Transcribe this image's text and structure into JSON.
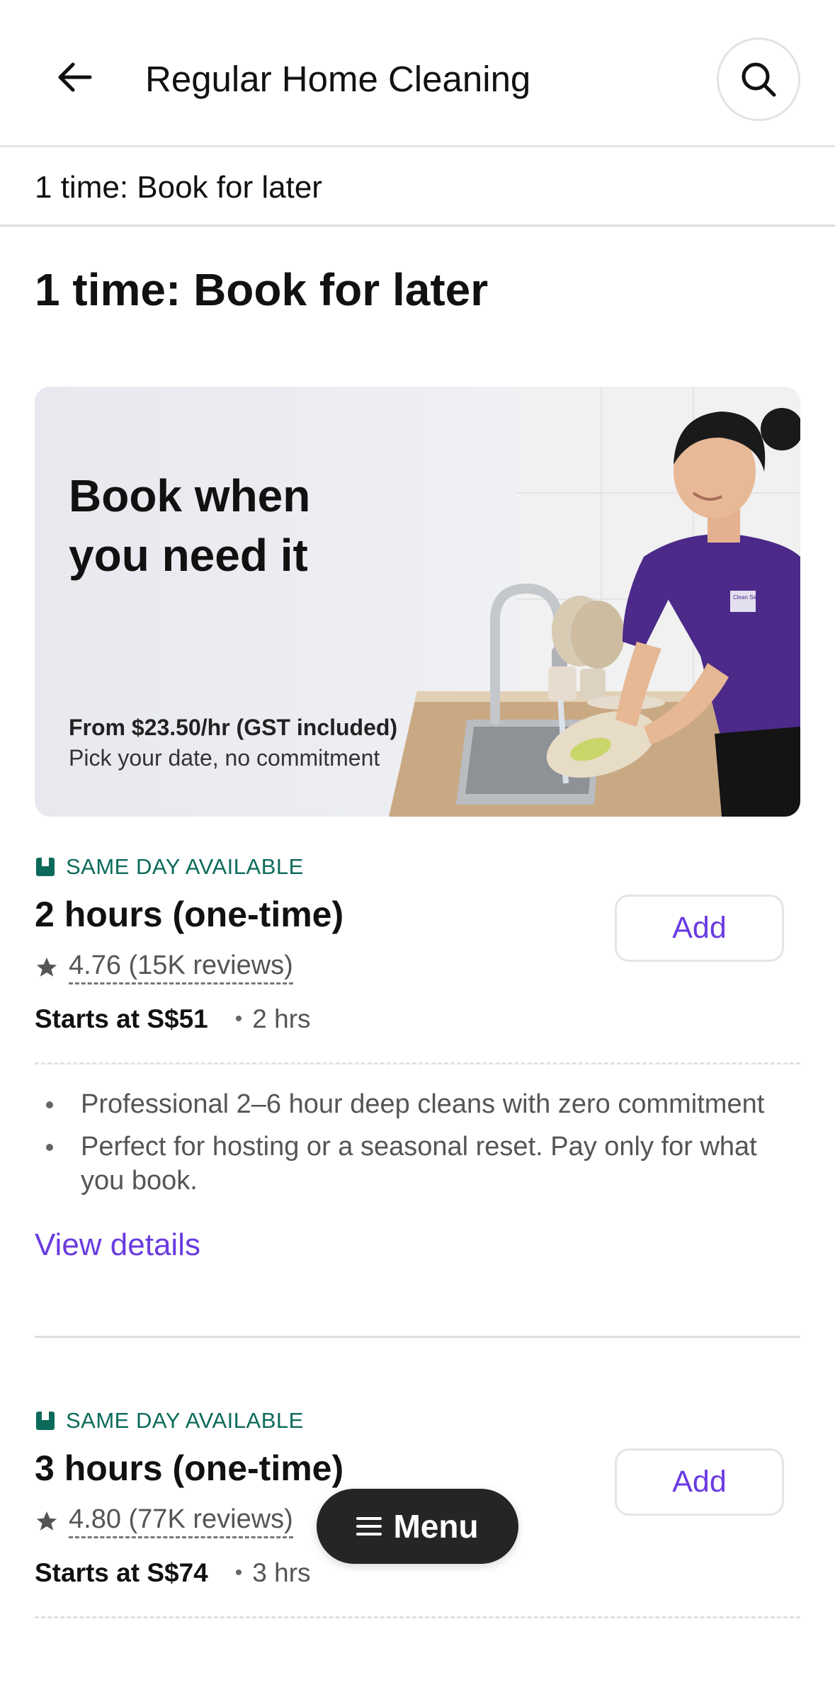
{
  "header": {
    "title": "Regular Home Cleaning",
    "back_icon": "arrow-left-icon",
    "search_icon": "search-icon"
  },
  "section_bar": {
    "label": "1 time: Book for later"
  },
  "section_heading": "1 time: Book for later",
  "banner": {
    "title": "Book when you need it",
    "price_line": "From $23.50/hr (GST included)",
    "subtitle": "Pick your date, no commitment",
    "shirt_logo": "Clean Services"
  },
  "services": [
    {
      "badge": "SAME DAY AVAILABLE",
      "title": "2 hours (one-time)",
      "rating": "4.76 (15K reviews)",
      "price": "Starts at S$51",
      "duration": "2 hrs",
      "add_label": "Add",
      "bullets": [
        "Professional 2–6 hour deep cleans with zero commitment",
        "Perfect for hosting or a seasonal reset. Pay only for what you book."
      ],
      "view_details": "View details"
    },
    {
      "badge": "SAME DAY AVAILABLE",
      "title": "3 hours (one-time)",
      "rating": "4.80 (77K reviews)",
      "price": "Starts at S$74",
      "duration": "3 hrs",
      "add_label": "Add"
    }
  ],
  "menu_button": {
    "label": "Menu",
    "icon": "hamburger-icon"
  },
  "colors": {
    "accent": "#6a3be0",
    "badge_green": "#0b6a5a",
    "menu_bg": "#252525"
  }
}
